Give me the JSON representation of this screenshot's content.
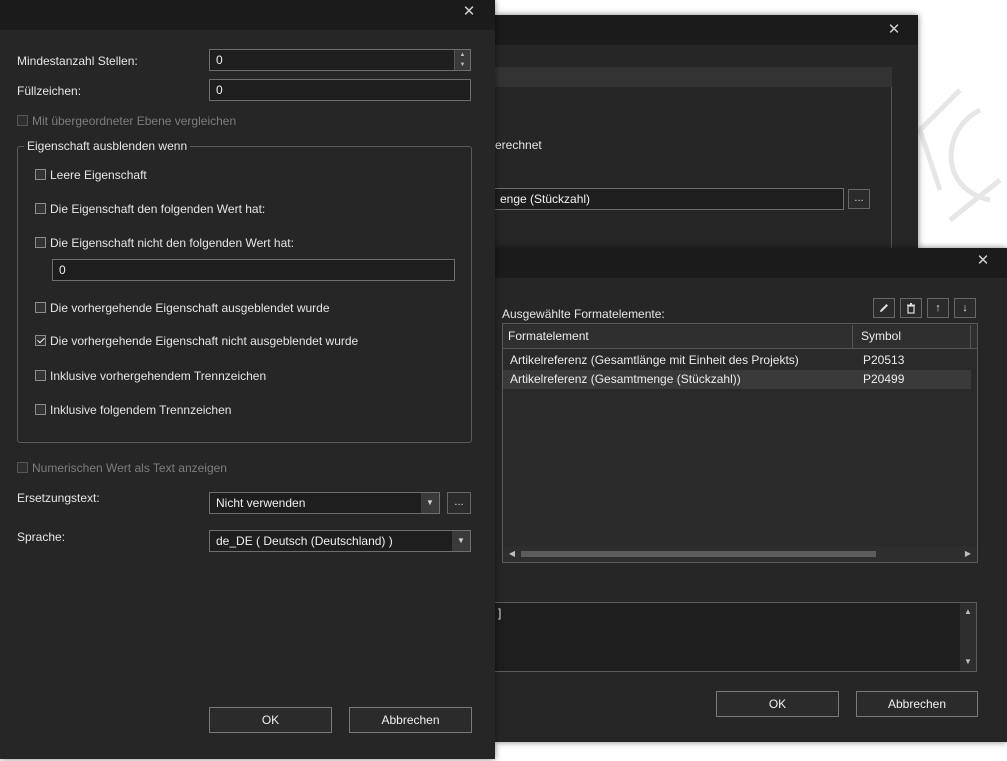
{
  "watermark": {},
  "win_back": {
    "close": "✕",
    "label_partial": "erechnet",
    "field_value": "enge (Stückzahl)",
    "browse_label": "..."
  },
  "win_mid": {
    "close": "✕",
    "list_label": "Ausgewählte Formatelemente:",
    "toolbar": {
      "edit_icon": "pencil-icon",
      "delete_icon": "trash-icon",
      "up": "↑",
      "down": "↓"
    },
    "table": {
      "headers": [
        "Formatelement",
        "Symbol"
      ],
      "rows": [
        {
          "element": "Artikelreferenz (Gesamtlänge mit Einheit des Projekts)",
          "symbol": "P20513"
        },
        {
          "element": "Artikelreferenz (Gesamtmenge (Stückzahl))",
          "symbol": "P20499"
        }
      ]
    },
    "text_value": "]",
    "ok_label": "OK",
    "cancel_label": "Abbrechen"
  },
  "win_front": {
    "close": "✕",
    "min_digits_label": "Mindestanzahl Stellen:",
    "min_digits_value": "0",
    "fill_char_label": "Füllzeichen:",
    "fill_char_value": "0",
    "compare_parent_label": "Mit übergeordneter Ebene vergleichen",
    "hide_group_label": "Eigenschaft ausblenden wenn",
    "options": [
      {
        "label": "Leere Eigenschaft",
        "checked": false
      },
      {
        "label": "Die Eigenschaft den folgenden Wert hat:",
        "checked": false
      },
      {
        "label": "Die Eigenschaft nicht den folgenden Wert hat:",
        "checked": false
      },
      {
        "label": "Die vorhergehende Eigenschaft ausgeblendet wurde",
        "checked": false
      },
      {
        "label": "Die vorhergehende Eigenschaft nicht ausgeblendet wurde",
        "checked": true
      },
      {
        "label": "Inklusive vorhergehendem Trennzeichen",
        "checked": false
      },
      {
        "label": "Inklusive folgendem Trennzeichen",
        "checked": false
      }
    ],
    "value_field": "0",
    "numeric_text_label": "Numerischen Wert als Text anzeigen",
    "replacement_label": "Ersetzungstext:",
    "replacement_value": "Nicht verwenden",
    "replacement_browse": "...",
    "language_label": "Sprache:",
    "language_value": "de_DE ( Deutsch (Deutschland) )",
    "ok_label": "OK",
    "cancel_label": "Abbrechen"
  }
}
